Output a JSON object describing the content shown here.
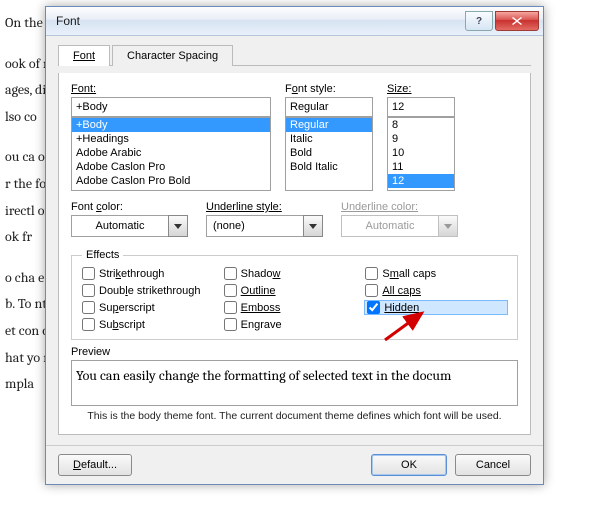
{
  "bg": {
    "p1": "On the                                                                                                                                                            the overall",
    "p2": "ook of                                                                                                                                                          rs, lists, cov",
    "p3": "ages,                                                                                                                                                        diagrams, th",
    "p4": "lso co",
    "p5": "ou ca                                                                                                                                                       osing a look",
    "p6": "r the                                                                                                                                                          format text",
    "p7": "irectl                                                                                                                                                       of using thi",
    "p8": "ok fr",
    "p9": "o cha                                                                                                                                                       e Page Layo",
    "p10": "b. To                                                                                                                                                      nt Quick St",
    "p11": "et con                                                                                                                                                       commands",
    "p12": "hat yo                                                                                                                                                       n your curre",
    "p13": "mpla"
  },
  "dialog": {
    "title": "Font",
    "tabs": {
      "font": "Font",
      "spacing": "Character Spacing"
    },
    "labels": {
      "font": "Font:",
      "style": "Font style:",
      "size": "Size:",
      "fontcolor": "Font color:",
      "underlinestyle": "Underline style:",
      "underlinecolor": "Underline color:"
    },
    "font_input": "+Body",
    "fonts": [
      "+Body",
      "+Headings",
      "Adobe Arabic",
      "Adobe Caslon Pro",
      "Adobe Caslon Pro Bold"
    ],
    "style_input": "Regular",
    "styles": [
      "Regular",
      "Italic",
      "Bold",
      "Bold Italic"
    ],
    "size_input": "12",
    "sizes": [
      "8",
      "9",
      "10",
      "11",
      "12"
    ],
    "fontcolor_val": "Automatic",
    "underlinestyle_val": "(none)",
    "underlinecolor_val": "Automatic",
    "effects_legend": "Effects",
    "effects": {
      "strike": "Strikethrough",
      "dstrike": "Double strikethrough",
      "super": "Superscript",
      "sub": "Subscript",
      "shadow": "Shadow",
      "outline": "Outline",
      "emboss": "Emboss",
      "engrave": "Engrave",
      "smallcaps": "Small caps",
      "allcaps": "All caps",
      "hidden": "Hidden"
    },
    "preview_label": "Preview",
    "preview_text": "You can easily change the formatting of selected text in the docum",
    "preview_note": "This is the body theme font. The current document theme defines which font will be used.",
    "buttons": {
      "default": "Default...",
      "ok": "OK",
      "cancel": "Cancel"
    }
  }
}
